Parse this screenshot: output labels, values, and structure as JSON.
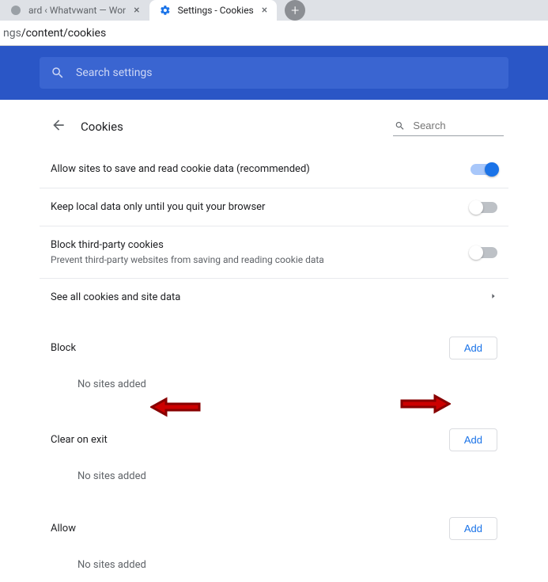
{
  "tabs": [
    {
      "title": "ard ‹ Whatvwant — Wor",
      "active": false
    },
    {
      "title": "Settings - Cookies",
      "active": true
    }
  ],
  "addressbar": {
    "prefix": "ngs",
    "path": "/content/cookies"
  },
  "toolbar": {
    "search_placeholder": "Search settings"
  },
  "header": {
    "title": "Cookies",
    "search_placeholder": "Search"
  },
  "rows": {
    "allow_save": {
      "label": "Allow sites to save and read cookie data (recommended)",
      "on": true
    },
    "keep_local": {
      "label": "Keep local data only until you quit your browser",
      "on": false
    },
    "block_third": {
      "label": "Block third-party cookies",
      "sub": "Prevent third-party websites from saving and reading cookie data",
      "on": false
    },
    "see_all": {
      "label": "See all cookies and site data"
    }
  },
  "sections": {
    "block": {
      "title": "Block",
      "add": "Add",
      "empty": "No sites added"
    },
    "clear": {
      "title": "Clear on exit",
      "add": "Add",
      "empty": "No sites added"
    },
    "allow": {
      "title": "Allow",
      "add": "Add",
      "empty": "No sites added"
    }
  }
}
